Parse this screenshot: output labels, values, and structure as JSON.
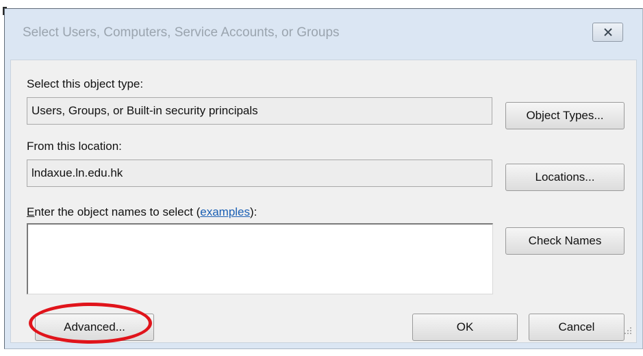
{
  "window": {
    "title": "Select Users, Computers, Service Accounts, or Groups"
  },
  "object_type": {
    "label": "Select this object type:",
    "value": "Users, Groups, or Built-in security principals",
    "button_label": "Object Types..."
  },
  "location": {
    "label": "From this location:",
    "value": "lndaxue.ln.edu.hk",
    "button_label": "Locations..."
  },
  "names": {
    "label_first_letter": "E",
    "label_rest": "nter the object names to select (",
    "link_text": "examples",
    "label_end": "):",
    "input_value": "",
    "check_button_label": "Check Names"
  },
  "footer": {
    "advanced_label": "Advanced...",
    "ok_label": "OK",
    "cancel_label": "Cancel"
  },
  "icons": {
    "close": "close-icon",
    "grip": "resize-grip-icon"
  },
  "colors": {
    "annotation": "#e0141b",
    "link": "#1a5fb4"
  }
}
